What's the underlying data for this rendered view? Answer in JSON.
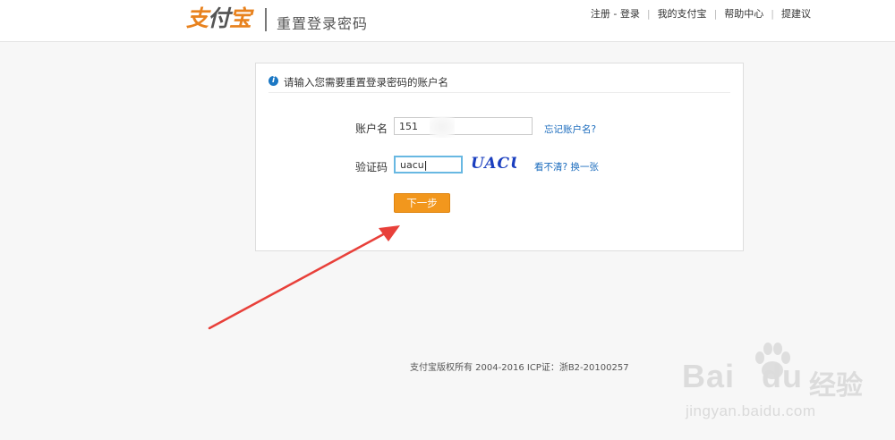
{
  "header": {
    "logo_text": "支付宝",
    "page_title": "重置登录密码",
    "nav": {
      "register_login": "注册 - 登录",
      "my_alipay": "我的支付宝",
      "help_center": "帮助中心",
      "suggestion": "提建议",
      "separator": "|"
    }
  },
  "form": {
    "notice": "请输入您需要重置登录密码的账户名",
    "account_label": "账户名",
    "account_value": "151",
    "forgot_account_link": "忘记账户名?",
    "captcha_label": "验证码",
    "captcha_value": "uacu",
    "captcha_image_text": "UACU",
    "refresh_captcha_link": "看不清? 换一张",
    "next_button": "下一步"
  },
  "footer": {
    "copyright": "支付宝版权所有 2004-2016 ICP证：浙B2-20100257"
  },
  "watermark": {
    "brand": "Bai",
    "brand_tail": "du",
    "brand_suffix": "经验",
    "url": "jingyan.baidu.com"
  },
  "colors": {
    "accent_orange": "#f2971d",
    "link_blue": "#1a6bbd",
    "arrow_red": "#e8403a",
    "focus_border": "#68b8e2"
  },
  "icons": [
    "info-icon",
    "arrow-annotation",
    "paw-icon"
  ]
}
